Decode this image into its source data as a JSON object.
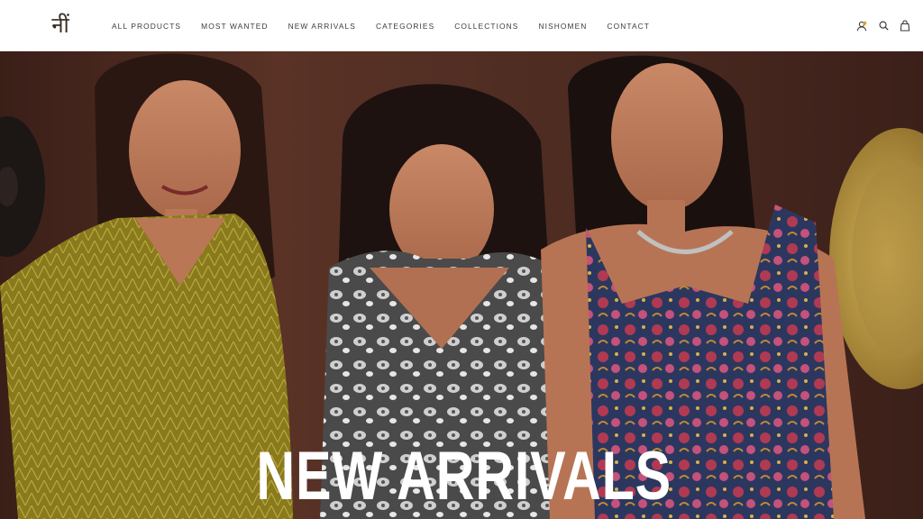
{
  "brand": {
    "logo_text": "नीं"
  },
  "nav": {
    "items": [
      {
        "label": "ALL PRODUCTS"
      },
      {
        "label": "MOST WANTED"
      },
      {
        "label": "NEW ARRIVALS"
      },
      {
        "label": "CATEGORIES"
      },
      {
        "label": "COLLECTIONS"
      },
      {
        "label": "NISHOMEN"
      },
      {
        "label": "CONTACT"
      }
    ]
  },
  "header_icons": [
    "account-icon",
    "search-icon",
    "cart-icon"
  ],
  "colors": {
    "account_icon": "#e0a020",
    "header_bg": "#ffffff",
    "nav_text": "#3b3b3b",
    "hero_bg": "#4e2c22",
    "hero_title": "#ffffff"
  },
  "hero": {
    "title": "NEW ARRIVALS"
  }
}
